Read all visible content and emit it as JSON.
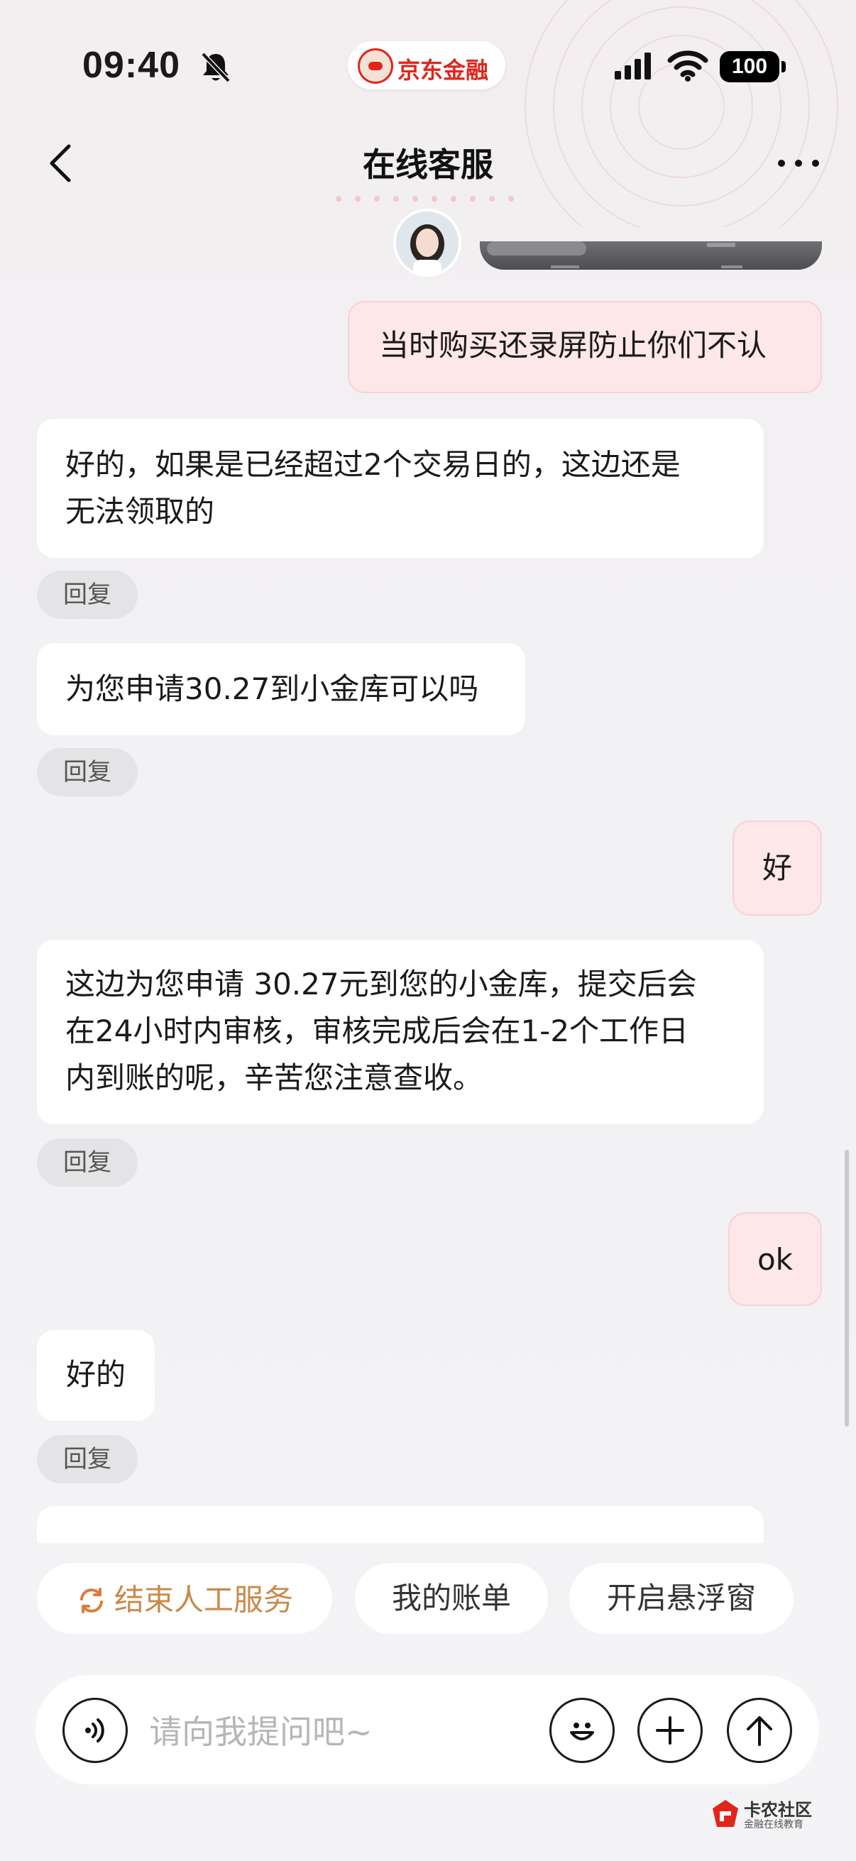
{
  "status_bar": {
    "time": "09:40",
    "battery": "100",
    "brand": "京东金融"
  },
  "nav": {
    "title": "在线客服"
  },
  "messages": [
    {
      "side": "right",
      "text": "当时购买还录屏防止你们不认"
    },
    {
      "side": "left",
      "lines": [
        "好的，如果是已经超过2个交易日的，这边还是",
        "无法领取的"
      ]
    },
    {
      "side": "left",
      "text": "为您申请30.27到小金库可以吗"
    },
    {
      "side": "right",
      "text": "好"
    },
    {
      "side": "left",
      "lines": [
        "这边为您申请 30.27元到您的小金库，提交后会",
        "在24小时内审核，审核完成后会在1-2个工作日",
        "内到账的呢，辛苦您注意查收。"
      ]
    },
    {
      "side": "right",
      "text": "ok"
    },
    {
      "side": "left",
      "text": "好的"
    }
  ],
  "reply_label": "回复",
  "quick_actions": [
    "结束人工服务",
    "我的账单",
    "开启悬浮窗"
  ],
  "input": {
    "placeholder": "请向我提问吧~"
  },
  "watermark": {
    "title": "卡农社区",
    "subtitle": "金融在线教育"
  },
  "colors": {
    "accent": "#e1251b",
    "user_bubble": "#fde7e8",
    "quick_primary": "#c88a4a"
  }
}
